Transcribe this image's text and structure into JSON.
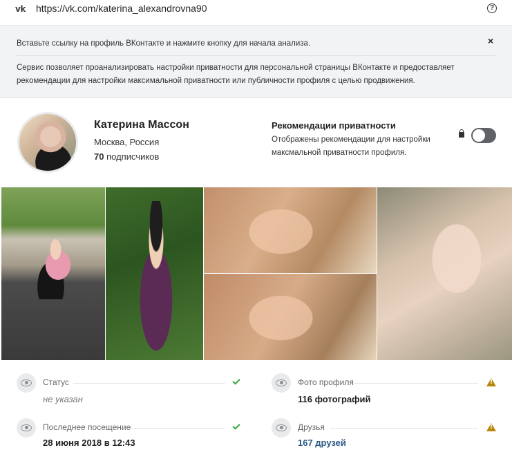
{
  "urlbar": {
    "logo": "vk",
    "url": "https://vk.com/katerina_alexandrovna90",
    "help": "?"
  },
  "info": {
    "hint": "Вставьте ссылку на профиль ВКонтакте и нажмите кнопку для начала анализа.",
    "close": "×",
    "description": "Сервис позволяет проанализировать настройки приватности для персональной страницы ВКонтакте и предоставляет рекомендации для настройки максимальной приватности или публичности профиля с целью продвижения."
  },
  "profile": {
    "name": "Катерина Массон",
    "city": "Москва, Россия",
    "followers_count": "70",
    "followers_label": "подписчиков"
  },
  "recommendations": {
    "title": "Рекомендации приватности",
    "description": "Отображены рекомендации для настройки максмальной приватности профиля.",
    "toggle_on": false
  },
  "stats": {
    "status": {
      "label": "Статус",
      "value": "не указан",
      "state": "ok"
    },
    "last_seen": {
      "label": "Последнее посещение",
      "value": "28 июня 2018 в 12:43",
      "state": "ok"
    },
    "photos": {
      "label": "Фото профиля",
      "value": "116 фотографий",
      "state": "warning"
    },
    "friends": {
      "label": "Друзья",
      "value": "167 друзей",
      "state": "warning"
    }
  },
  "colors": {
    "ok": "#3aa63a",
    "warning": "#b8860b",
    "link": "#2a5885",
    "toggle_off": "#5f6167"
  }
}
